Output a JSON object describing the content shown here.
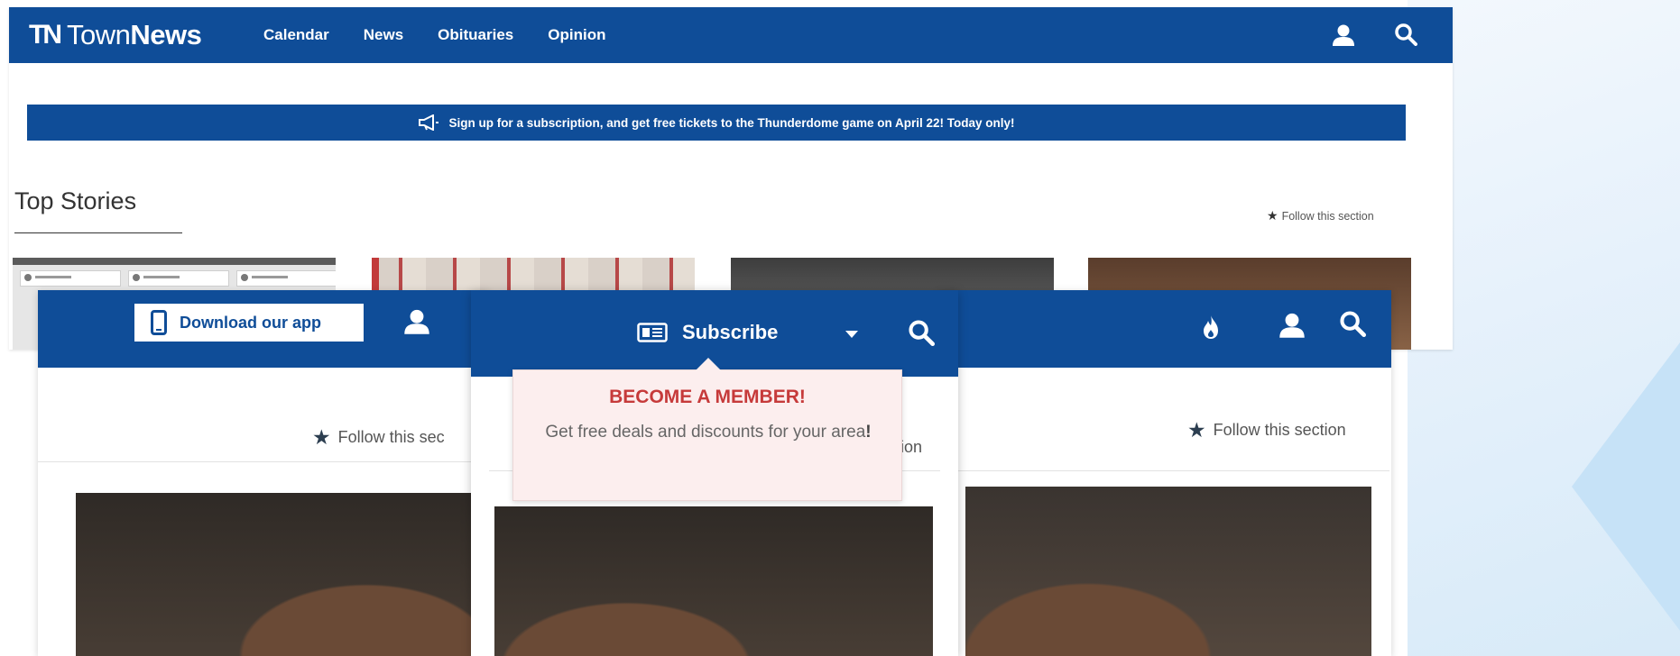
{
  "screenshot1": {
    "logo_mark": "TN",
    "logo_word_plain": "Town",
    "logo_word_bold": "News",
    "nav": [
      "Calendar",
      "News",
      "Obituaries",
      "Opinion"
    ],
    "promo_text": "Sign up for a subscription, and get free tickets to the Thunderdome game on April 22! Today only!",
    "section_title": "Top Stories",
    "follow_label": "Follow this section"
  },
  "screenshot2": {
    "app_button_label": "Download our app",
    "follow_label": "Follow this sec"
  },
  "screenshot3": {
    "subscribe_label": "Subscribe",
    "popover_title": "BECOME A MEMBER!",
    "popover_body": "Get free deals and discounts for your area",
    "popover_body_emphasis": "!",
    "follow_fragment": "ion"
  },
  "screenshot4": {
    "follow_label": "Follow this section"
  },
  "icons": {
    "user": "user-icon",
    "search": "search-icon",
    "megaphone": "megaphone-icon",
    "star": "star-icon",
    "phone": "phone-icon",
    "newspaper": "newspaper-icon",
    "caret": "caret-down-icon",
    "fire": "fire-icon"
  },
  "colors": {
    "brand_blue": "#0f4d98",
    "popover_bg": "#fceeee",
    "popover_title": "#c63a3a"
  }
}
